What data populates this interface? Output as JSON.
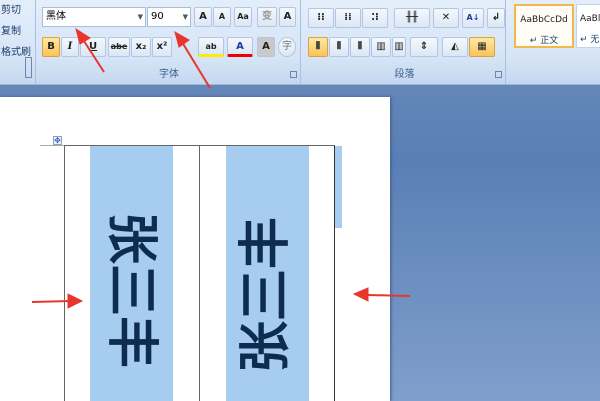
{
  "clipboard": {
    "cut": "剪切",
    "copy": "复制",
    "format_painter": "格式刷"
  },
  "font": {
    "font_name": "黑体",
    "font_size": "90",
    "group_label": "字体",
    "grow": "A",
    "shrink": "A",
    "bold": "B",
    "italic": "I",
    "underline": "U",
    "strike": "abe",
    "subscript": "x₂",
    "superscript": "x²",
    "case": "Aa",
    "highlight": "ab",
    "font_color": "A",
    "char_shading": "A",
    "enclose": "字",
    "phonetic": "变",
    "char_border": "A"
  },
  "paragraph": {
    "group_label": "段落"
  },
  "styles": [
    {
      "preview": "AaBbCcDd",
      "name": "正文"
    },
    {
      "preview": "AaBl",
      "name": "无"
    }
  ],
  "document": {
    "cell1_text": "张三丰",
    "cell2_text": "张三丰",
    "para_mark": "↵"
  },
  "colors": {
    "accent_arrow": "#e8362d",
    "cell_shading": "#a6cdf0",
    "text": "#0d2c4f"
  }
}
